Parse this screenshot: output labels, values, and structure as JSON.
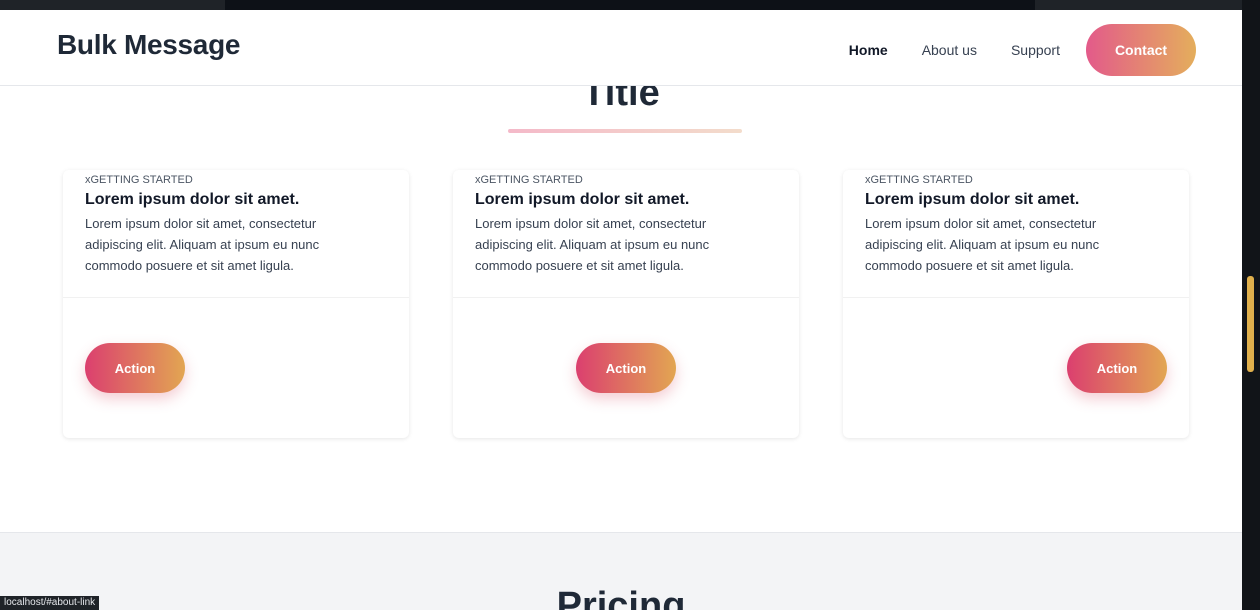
{
  "navbar": {
    "brand": "Bulk Message",
    "links": [
      "Home",
      "About us",
      "Support"
    ],
    "contact": "Contact"
  },
  "section": {
    "title": "Title"
  },
  "cards": [
    {
      "kicker": "xGETTING STARTED",
      "title": "Lorem ipsum dolor sit amet.",
      "text": "Lorem ipsum dolor sit amet, consectetur adipiscing elit. Aliquam at ipsum eu nunc commodo posuere et sit amet ligula.",
      "action": "Action"
    },
    {
      "kicker": "xGETTING STARTED",
      "title": "Lorem ipsum dolor sit amet.",
      "text": "Lorem ipsum dolor sit amet, consectetur adipiscing elit. Aliquam at ipsum eu nunc commodo posuere et sit amet ligula.",
      "action": "Action"
    },
    {
      "kicker": "xGETTING STARTED",
      "title": "Lorem ipsum dolor sit amet.",
      "text": "Lorem ipsum dolor sit amet, consectetur adipiscing elit. Aliquam at ipsum eu nunc commodo posuere et sit amet ligula.",
      "action": "Action"
    }
  ],
  "pricing": {
    "title": "Pricing"
  },
  "status_bar": {
    "url": "localhost/#about-link"
  },
  "colors": {
    "gradient_start": "#db3f6f",
    "gradient_end": "#e2a652",
    "scroll_thumb": "#e0b04c"
  }
}
